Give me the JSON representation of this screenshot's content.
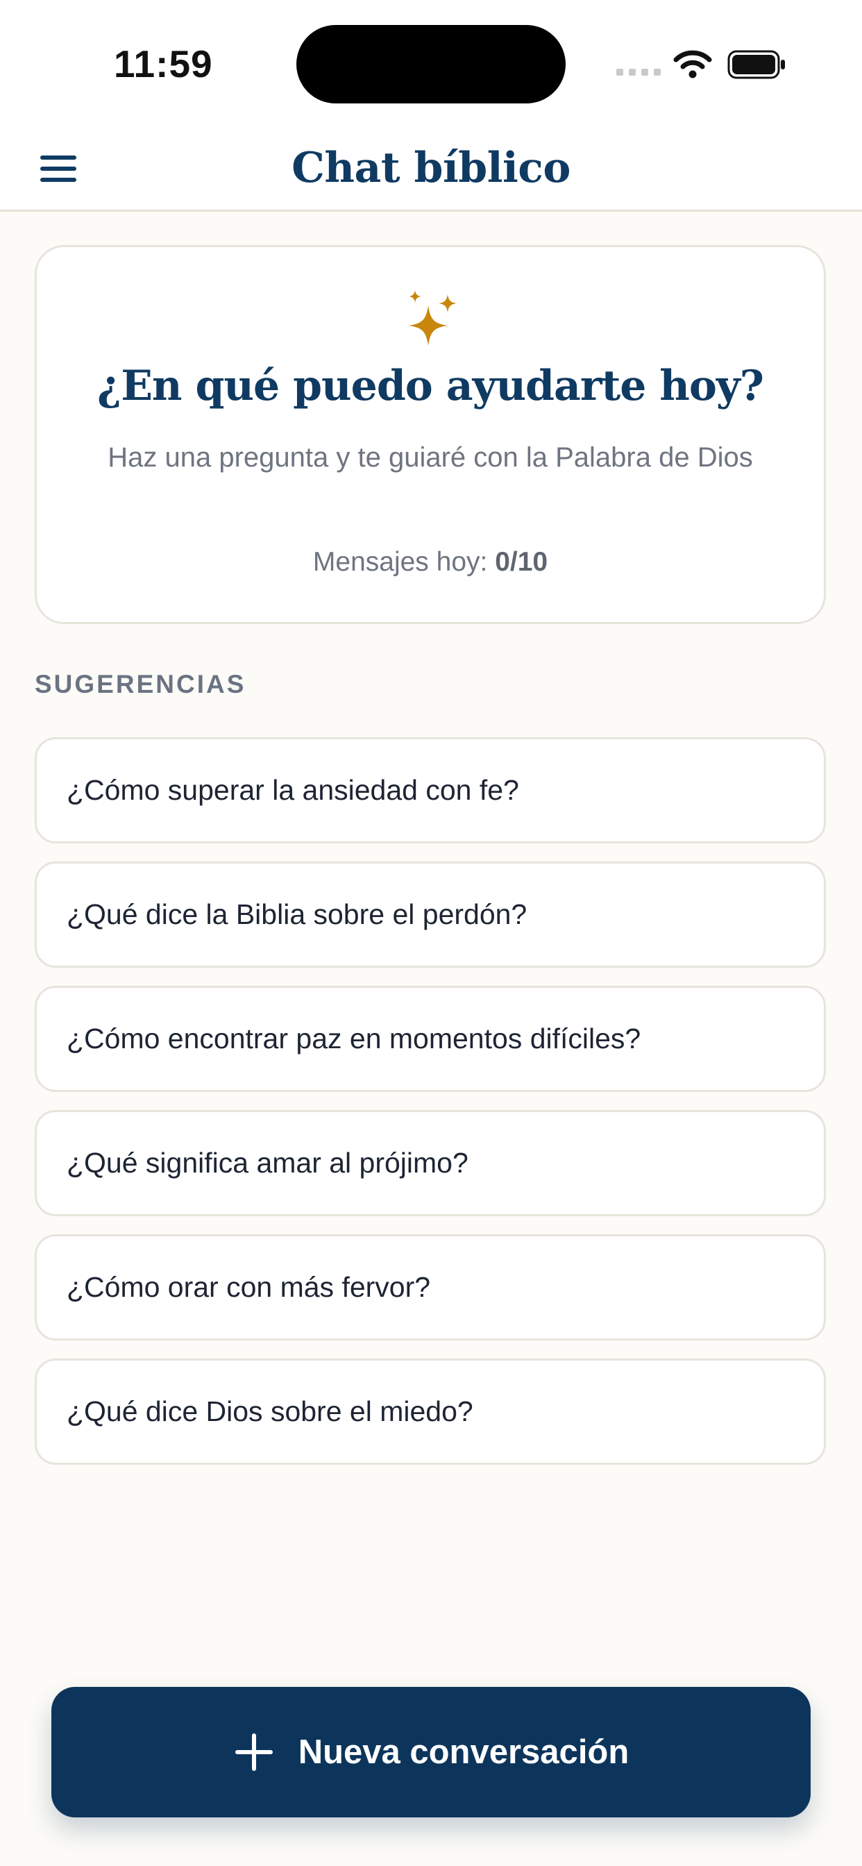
{
  "status_bar": {
    "time": "11:59"
  },
  "header": {
    "title": "Chat bíblico",
    "menu_icon": "hamburger-menu-icon"
  },
  "welcome": {
    "icon": "sparkles-icon",
    "heading": "¿En qué puedo ayudarte hoy?",
    "subtitle": "Haz una pregunta y te guiaré con la Palabra de Dios",
    "messages_label": "Mensajes hoy:",
    "messages_value": "0/10"
  },
  "suggestions": {
    "heading": "SUGERENCIAS",
    "items": [
      "¿Cómo superar la ansiedad con fe?",
      "¿Qué dice la Biblia sobre el perdón?",
      "¿Cómo encontrar paz en momentos difíciles?",
      "¿Qué significa amar al prójimo?",
      "¿Cómo orar con más fervor?",
      "¿Qué dice Dios sobre el miedo?"
    ]
  },
  "actions": {
    "new_conversation_label": "Nueva conversación",
    "new_conversation_icon": "plus-icon"
  },
  "colors": {
    "primary": "#0F3A62",
    "accent": "#C8860D",
    "background": "#FCFBF7"
  }
}
